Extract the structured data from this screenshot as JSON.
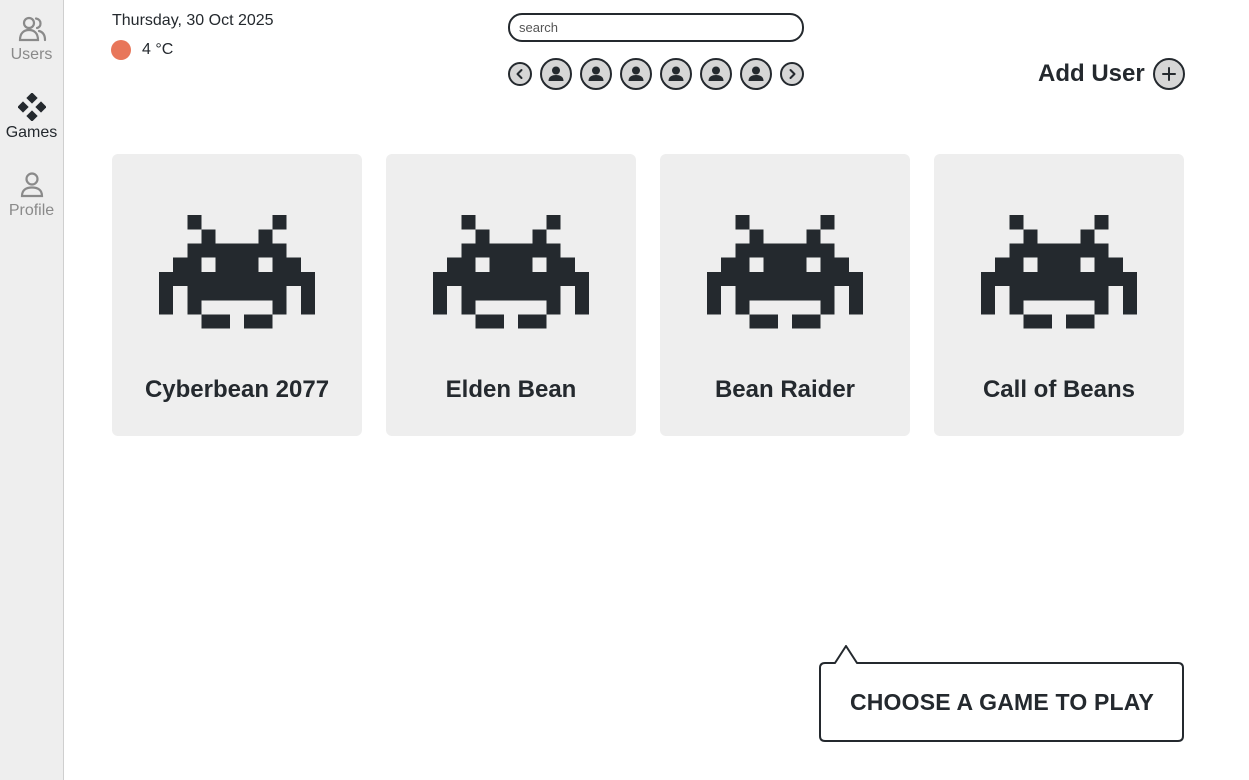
{
  "sidebar": {
    "items": [
      {
        "label": "Users",
        "icon": "users-icon",
        "active": false
      },
      {
        "label": "Games",
        "icon": "gamepad-icon",
        "active": true
      },
      {
        "label": "Profile",
        "icon": "person-icon",
        "active": false
      }
    ]
  },
  "header": {
    "date": "Thursday, 30 Oct 2025",
    "weather": {
      "temperature": "4 °C",
      "indicator_color": "#e8765a"
    }
  },
  "search": {
    "placeholder": "search",
    "value": ""
  },
  "users": {
    "avatars": [
      "user-avatar-icon",
      "user-avatar-icon",
      "user-avatar-icon",
      "user-avatar-icon",
      "user-avatar-icon",
      "user-avatar-icon"
    ],
    "prev_icon": "chevron-left-icon",
    "next_icon": "chevron-right-icon",
    "add_user_label": "Add User",
    "add_icon": "plus-icon"
  },
  "games": [
    {
      "title": "Cyberbean 2077",
      "icon": "space-invader-icon"
    },
    {
      "title": "Elden Bean",
      "icon": "space-invader-icon"
    },
    {
      "title": "Bean Raider",
      "icon": "space-invader-icon"
    },
    {
      "title": "Call of Beans",
      "icon": "space-invader-icon"
    }
  ],
  "prompt": {
    "text": "CHOOSE A GAME TO PLAY"
  },
  "colors": {
    "sidebar_bg": "#eeeeee",
    "card_bg": "#eeeeee",
    "ink": "#24292e",
    "avatar_bg": "#d6d6d6",
    "weather_dot": "#e8765a"
  }
}
